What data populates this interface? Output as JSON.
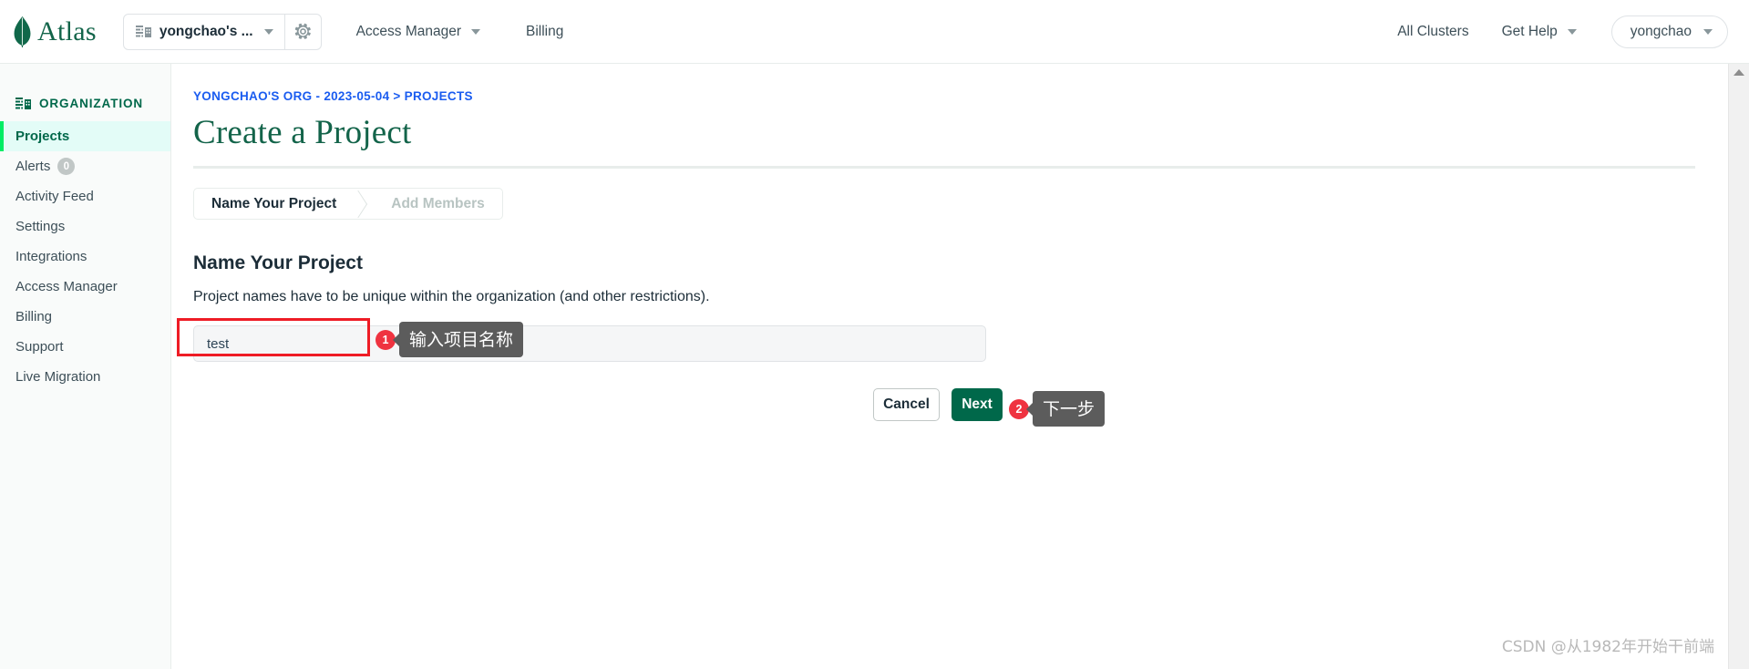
{
  "brand": {
    "name": "Atlas",
    "logo_icon": "mongodb-leaf-icon",
    "color": "#13654a"
  },
  "topnav": {
    "org_switcher": {
      "icon": "organization-icon",
      "label": "yongchao's ...",
      "caret_icon": "chevron-down-icon",
      "settings_icon": "gear-icon"
    },
    "links": [
      {
        "label": "Access Manager",
        "has_caret": true
      },
      {
        "label": "Billing",
        "has_caret": false
      }
    ],
    "right_links": [
      {
        "label": "All Clusters",
        "has_caret": false
      },
      {
        "label": "Get Help",
        "has_caret": true
      }
    ],
    "user": {
      "label": "yongchao",
      "caret_icon": "chevron-down-icon"
    }
  },
  "sidebar": {
    "header": {
      "label": "ORGANIZATION",
      "icon": "organization-icon",
      "color": "#00684a"
    },
    "items": [
      {
        "label": "Projects",
        "active": true,
        "badge": null
      },
      {
        "label": "Alerts",
        "active": false,
        "badge": "0"
      },
      {
        "label": "Activity Feed",
        "active": false,
        "badge": null
      },
      {
        "label": "Settings",
        "active": false,
        "badge": null
      },
      {
        "label": "Integrations",
        "active": false,
        "badge": null
      },
      {
        "label": "Access Manager",
        "active": false,
        "badge": null
      },
      {
        "label": "Billing",
        "active": false,
        "badge": null
      },
      {
        "label": "Support",
        "active": false,
        "badge": null
      },
      {
        "label": "Live Migration",
        "active": false,
        "badge": null
      }
    ],
    "active_accent": "#00ed64",
    "active_bg": "#e3fcf7"
  },
  "main": {
    "breadcrumb": "YONGCHAO'S ORG - 2023-05-04 > PROJECTS",
    "breadcrumb_color": "#1a5cf0",
    "page_title": "Create a Project",
    "page_title_color": "#13644a",
    "tabs": [
      {
        "label": "Name Your Project",
        "active": true
      },
      {
        "label": "Add Members",
        "active": false
      }
    ],
    "section_title": "Name Your Project",
    "section_desc": "Project names have to be unique within the organization (and other restrictions).",
    "project_name_input": {
      "value": "test",
      "placeholder": ""
    },
    "buttons": {
      "cancel": "Cancel",
      "next": "Next",
      "next_color": "#00684a"
    }
  },
  "annotations": [
    {
      "marker": "1",
      "tooltip": "输入项目名称",
      "marker_color": "#ef3340",
      "tooltip_bg": "#5c5c5c",
      "highlight_color": "#ee1c25"
    },
    {
      "marker": "2",
      "tooltip": "下一步",
      "marker_color": "#ef3340",
      "tooltip_bg": "#5c5c5c"
    }
  ],
  "watermark": "CSDN @从1982年开始干前端",
  "scrollbar": {
    "up_arrow_icon": "triangle-up-icon"
  }
}
